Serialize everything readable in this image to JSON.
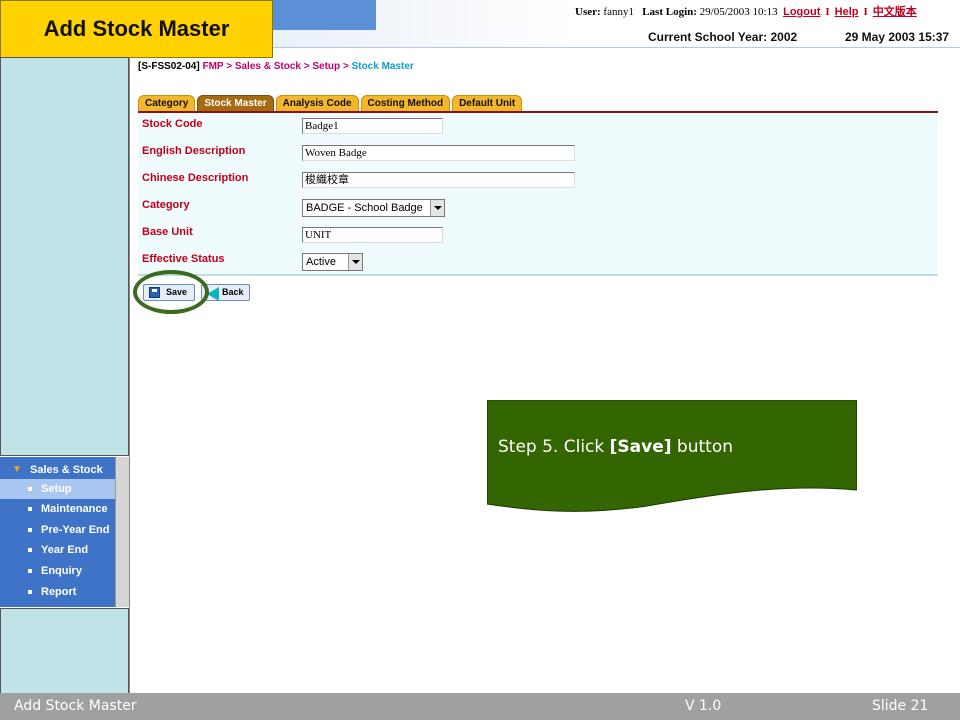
{
  "slide_title": "Add Stock Master",
  "header": {
    "user_label": "User:",
    "user_value": "fanny1",
    "last_login_label": "Last Login:",
    "last_login_value": "29/05/2003 10:13",
    "links": [
      "Logout",
      "Help",
      "中文版本"
    ],
    "separator": "I",
    "school_year": "Current School Year: 2002",
    "datetime": "29 May 2003 15:37"
  },
  "breadcrumb": {
    "code": "[S-FSS02-04]",
    "path": [
      "FMP",
      "Sales & Stock",
      "Setup"
    ],
    "separator": ">",
    "current": "Stock Master"
  },
  "tabs": [
    {
      "label": "Category",
      "active": false
    },
    {
      "label": "Stock Master",
      "active": true
    },
    {
      "label": "Analysis Code",
      "active": false
    },
    {
      "label": "Costing Method",
      "active": false
    },
    {
      "label": "Default Unit",
      "active": false
    }
  ],
  "form": {
    "stock_code": {
      "label": "Stock Code",
      "value": "Badge1"
    },
    "english_desc": {
      "label": "English Description",
      "value": "Woven Badge"
    },
    "chinese_desc": {
      "label": "Chinese Description",
      "value": "梭織校章"
    },
    "category": {
      "label": "Category",
      "value": "BADGE - School Badge"
    },
    "base_unit": {
      "label": "Base Unit",
      "value": "UNIT"
    },
    "effective_status": {
      "label": "Effective Status",
      "value": "Active"
    }
  },
  "buttons": {
    "save": "Save",
    "back": "Back"
  },
  "nav": {
    "header": "Sales & Stock",
    "items": [
      {
        "label": "Setup",
        "active": true
      },
      {
        "label": "Maintenance",
        "active": false
      },
      {
        "label": "Pre-Year End",
        "active": false
      },
      {
        "label": "Year End",
        "active": false
      },
      {
        "label": "Enquiry",
        "active": false
      },
      {
        "label": "Report",
        "active": false
      }
    ]
  },
  "callout": {
    "prefix": "Step 5. Click ",
    "highlight": "[Save]",
    "suffix": " button"
  },
  "footer": {
    "left": "Add Stock Master",
    "center": "V 1.0",
    "right": "Slide 21"
  },
  "colors": {
    "title_bg": "#ffd200",
    "callout_bg": "#336600",
    "nav_bg": "#3f73c7",
    "label_red": "#c00018",
    "highlight_circle": "#3a6b1f"
  }
}
